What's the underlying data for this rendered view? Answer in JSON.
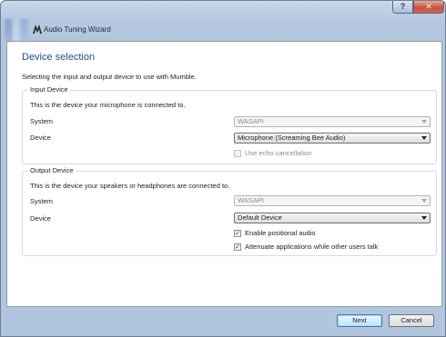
{
  "window": {
    "title": "Audio Tuning Wizard",
    "help_label": "?",
    "close_label": "✕"
  },
  "page": {
    "title": "Device selection",
    "subtitle": "Selecting the input and output device to use with Mumble."
  },
  "input_device": {
    "group_label": "Input Device",
    "description": "This is the device your microphone is connected to.",
    "system_label": "System",
    "system_value": "WASAPI",
    "device_label": "Device",
    "device_value": "Microphone (Screaming Bee Audio)",
    "echo_cancellation_label": "Use echo cancellation",
    "echo_cancellation_checked": false,
    "echo_cancellation_enabled": false
  },
  "output_device": {
    "group_label": "Output Device",
    "description": "This is the device your speakers or headphones are connected to.",
    "system_label": "System",
    "system_value": "WASAPI",
    "device_label": "Device",
    "device_value": "Default Device",
    "positional_audio_label": "Enable positional audio",
    "positional_audio_checked": true,
    "attenuate_label": "Attenuate applications while other users talk",
    "attenuate_checked": true
  },
  "buttons": {
    "next_label": "Next",
    "cancel_label": "Cancel"
  },
  "colors": {
    "accent": "#1f4e9d",
    "frame": "#b6c9e1"
  }
}
